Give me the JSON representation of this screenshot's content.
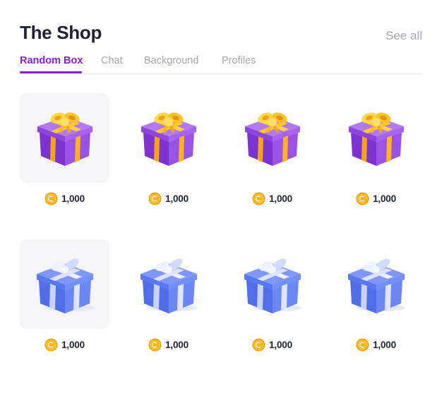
{
  "header": {
    "title": "The Shop",
    "see_all_label": "See all"
  },
  "tabs": [
    {
      "label": "Random Box",
      "active": true
    },
    {
      "label": "Chat",
      "active": false
    },
    {
      "label": "Background",
      "active": false
    },
    {
      "label": "Profiles",
      "active": false
    }
  ],
  "colors": {
    "accent": "#8a1fd8",
    "purple_box": "#8b3fd9",
    "gold_ribbon": "#ffc21a",
    "blue_box": "#5b7bf2",
    "silver_ribbon": "#d9e0ff",
    "coin": "#ffb21d"
  },
  "items": [
    {
      "box": "purple-gift-box-icon",
      "price": "1,000",
      "selected": true
    },
    {
      "box": "purple-gift-box-icon",
      "price": "1,000",
      "selected": false
    },
    {
      "box": "purple-gift-box-icon",
      "price": "1,000",
      "selected": false
    },
    {
      "box": "purple-gift-box-icon",
      "price": "1,000",
      "selected": false
    },
    {
      "box": "blue-gift-box-icon",
      "price": "1,000",
      "selected": true
    },
    {
      "box": "blue-gift-box-icon",
      "price": "1,000",
      "selected": false
    },
    {
      "box": "blue-gift-box-icon",
      "price": "1,000",
      "selected": false
    },
    {
      "box": "blue-gift-box-icon",
      "price": "1,000",
      "selected": false
    }
  ]
}
